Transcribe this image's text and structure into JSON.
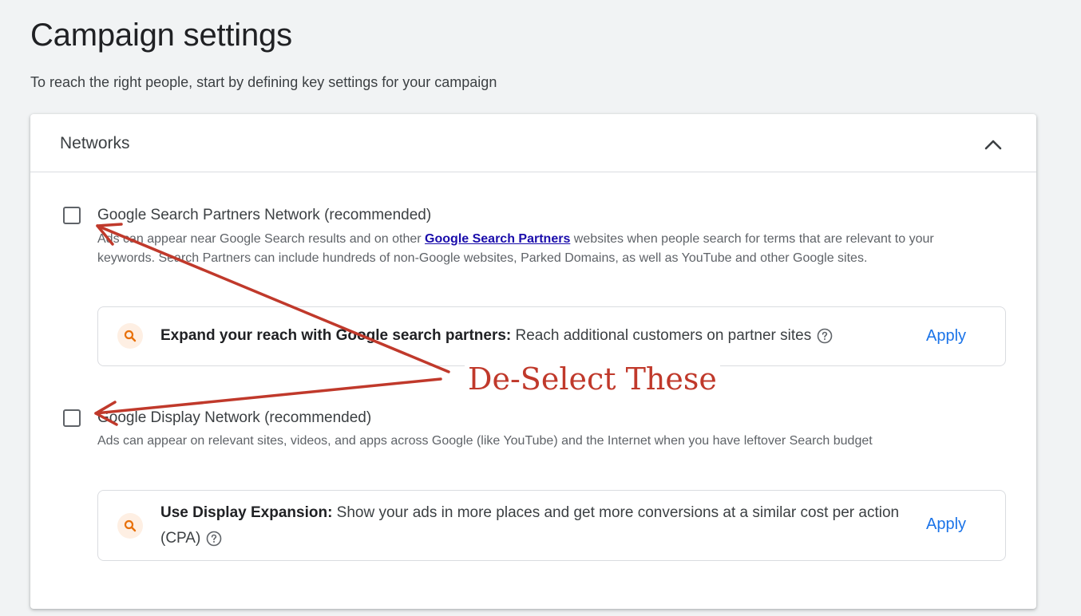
{
  "header": {
    "title": "Campaign settings",
    "subtitle": "To reach the right people, start by defining key settings for your campaign"
  },
  "networks": {
    "title": "Networks",
    "options": [
      {
        "title": "Google Search Partners Network (recommended)",
        "desc_before": "Ads can appear near Google Search results and on other ",
        "desc_link": "Google Search Partners",
        "desc_after": " websites when people search for terms that are relevant to your keywords. Search Partners can include hundreds of non-Google websites, Parked Domains, as well as YouTube and other Google sites.",
        "checked": false,
        "recommendation": {
          "bold": "Expand your reach with Google search partners:",
          "text": " Reach additional customers on partner sites",
          "apply": "Apply"
        }
      },
      {
        "title": "Google Display Network (recommended)",
        "desc": "Ads can appear on relevant sites, videos, and apps across Google (like YouTube) and the Internet when you have leftover Search budget",
        "checked": false,
        "recommendation": {
          "bold": "Use Display Expansion:",
          "text": " Show your ads in more places and get more conversions at a similar cost per action (CPA)",
          "apply": "Apply"
        }
      }
    ]
  },
  "annotation": {
    "label": "De-Select These",
    "color": "#c0392b"
  },
  "colors": {
    "accent": "#1a73e8",
    "link": "#1a0dab",
    "rec_icon_bg": "#feefe3",
    "rec_icon_fg": "#e8710a"
  },
  "icons": {
    "collapse": "chevron-up-icon",
    "recommendation": "search-icon",
    "help": "help-circle-icon"
  }
}
